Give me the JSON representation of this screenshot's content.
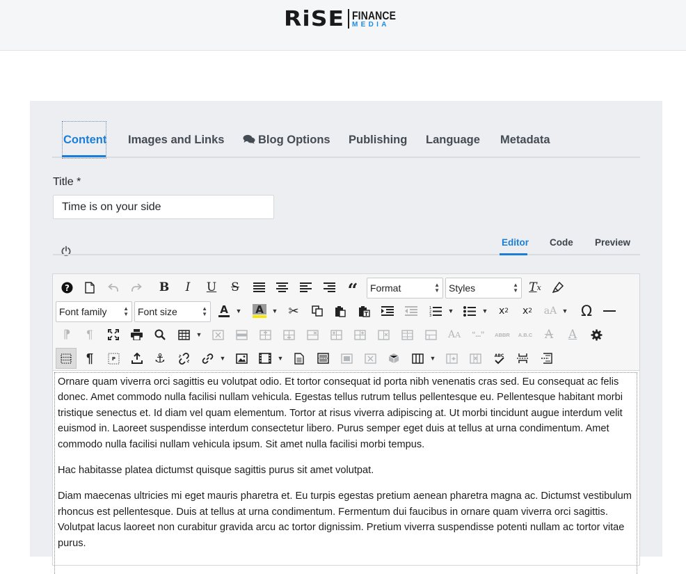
{
  "brand": {
    "logo_main": "RiSE",
    "logo_word_1": "FINANCE",
    "logo_word_2": "MEDIA",
    "accent_color": "#1a8ce8"
  },
  "tabs": [
    {
      "label": "Content",
      "active": true
    },
    {
      "label": "Images and Links",
      "active": false
    },
    {
      "label": "Blog Options",
      "icon": "comments-icon",
      "active": false
    },
    {
      "label": "Publishing",
      "active": false
    },
    {
      "label": "Language",
      "active": false
    },
    {
      "label": "Metadata",
      "active": false
    }
  ],
  "form": {
    "title_label": "Title *",
    "title_value": "Time is on your side"
  },
  "editor_tabs": [
    {
      "label": "Editor",
      "active": true
    },
    {
      "label": "Code",
      "active": false
    },
    {
      "label": "Preview",
      "active": false
    }
  ],
  "toolbar": {
    "format_select": "Format",
    "styles_select": "Styles",
    "font_family_select": "Font family",
    "font_size_select": "Font size",
    "row1_icons": [
      "help-icon",
      "new-document-icon",
      "undo-icon",
      "redo-icon",
      "bold-icon",
      "italic-icon",
      "underline-icon",
      "strikethrough-icon",
      "justify-icon",
      "align-center-icon",
      "align-left-icon",
      "align-right-icon",
      "blockquote-icon",
      "clear-formatting-icon",
      "paint-format-icon"
    ],
    "row2_icons": [
      "text-color-icon",
      "highlight-color-icon",
      "cut-icon",
      "copy-icon",
      "paste-icon",
      "paste-text-icon",
      "indent-icon",
      "outdent-icon",
      "numbered-list-icon",
      "bullet-list-icon",
      "subscript-icon",
      "superscript-icon",
      "change-case-icon",
      "special-character-icon",
      "horizontal-rule-icon"
    ],
    "row3_icons": [
      "ltr-icon",
      "rtl-icon",
      "fullscreen-icon",
      "print-icon",
      "search-replace-icon",
      "table-icon",
      "table-delete-icon",
      "table-row-props-icon",
      "table-insert-row-before-icon",
      "table-insert-row-after-icon",
      "table-delete-row-icon",
      "table-insert-col-before-icon",
      "table-insert-col-after-icon",
      "table-delete-col-icon",
      "table-split-cells-icon",
      "table-merge-cells-icon",
      "font-size-icon",
      "quotes-icon",
      "abbreviation-icon",
      "acronym-icon",
      "deletion-icon",
      "insertion-icon",
      "settings-icon"
    ],
    "row4_icons": [
      "visual-aid-icon",
      "show-blocks-icon",
      "paragraph-tag-icon",
      "upload-icon",
      "anchor-icon",
      "unlink-icon",
      "link-icon",
      "image-icon",
      "media-icon",
      "template-icon",
      "page-break-icon",
      "image-placeholder-icon",
      "delete-box-icon",
      "object-icon",
      "columns-icon",
      "column-add-icon",
      "column-delete-icon",
      "spellcheck-icon",
      "nonbreaking-icon",
      "readmore-icon"
    ],
    "text_color": "#222222",
    "highlight_color": "#f5e60a",
    "case_label": "aA",
    "abbr_label": "ABBR",
    "acronym_label": "A.B.C",
    "quotes_label": "“...”"
  },
  "content": {
    "paragraphs": [
      "Ornare quam viverra orci sagittis eu volutpat odio. Et tortor consequat id porta nibh venenatis cras sed. Eu consequat ac felis donec. Amet commodo nulla facilisi nullam vehicula. Egestas tellus rutrum tellus pellentesque eu. Pellentesque habitant morbi tristique senectus et. Id diam vel quam elementum. Tortor at risus viverra adipiscing at. Ut morbi tincidunt augue interdum velit euismod in. Laoreet suspendisse interdum consectetur libero. Purus semper eget duis at tellus at urna condimentum. Amet commodo nulla facilisi nullam vehicula ipsum. Sit amet nulla facilisi morbi tempus.",
      "Hac habitasse platea dictumst quisque sagittis purus sit amet volutpat.",
      "Diam maecenas ultricies mi eget mauris pharetra et. Eu turpis egestas pretium aenean pharetra magna ac. Dictumst vestibulum rhoncus est pellentesque. Duis at tellus at urna condimentum. Fermentum dui faucibus in ornare quam viverra orci sagittis. Volutpat lacus laoreet non curabitur gravida arcu ac tortor dignissim. Pretium viverra suspendisse potenti nullam ac tortor vitae purus."
    ]
  }
}
